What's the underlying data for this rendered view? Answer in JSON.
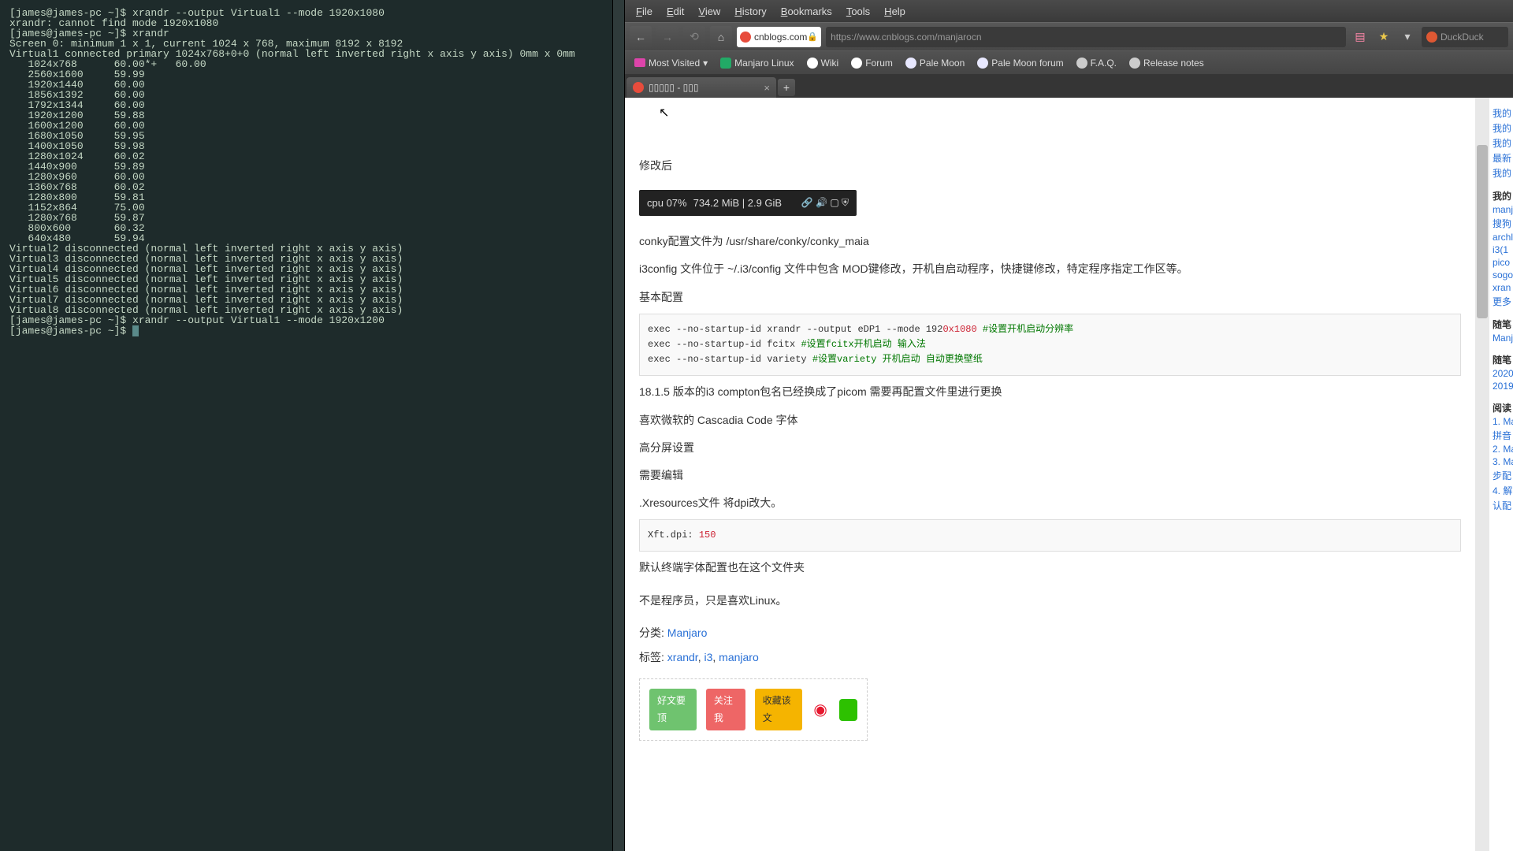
{
  "terminal": {
    "prompt": "[james@james-pc ~]$ ",
    "cmd1": "xrandr --output Virtual1 --mode 1920x1080",
    "err1": "xrandr: cannot find mode 1920x1080",
    "cmd2": "xrandr",
    "screen": "Screen 0: minimum 1 x 1, current 1024 x 768, maximum 8192 x 8192",
    "v1": "Virtual1 connected primary 1024x768+0+0 (normal left inverted right x axis y axis) 0mm x 0mm",
    "modes": [
      [
        "1024x768",
        "60.00*+",
        "60.00"
      ],
      [
        "2560x1600",
        "59.99",
        ""
      ],
      [
        "1920x1440",
        "60.00",
        ""
      ],
      [
        "1856x1392",
        "60.00",
        ""
      ],
      [
        "1792x1344",
        "60.00",
        ""
      ],
      [
        "1920x1200",
        "59.88",
        ""
      ],
      [
        "1600x1200",
        "60.00",
        ""
      ],
      [
        "1680x1050",
        "59.95",
        ""
      ],
      [
        "1400x1050",
        "59.98",
        ""
      ],
      [
        "1280x1024",
        "60.02",
        ""
      ],
      [
        "1440x900",
        "59.89",
        ""
      ],
      [
        "1280x960",
        "60.00",
        ""
      ],
      [
        "1360x768",
        "60.02",
        ""
      ],
      [
        "1280x800",
        "59.81",
        ""
      ],
      [
        "1152x864",
        "75.00",
        ""
      ],
      [
        "1280x768",
        "59.87",
        ""
      ],
      [
        "800x600",
        "60.32",
        ""
      ],
      [
        "640x480",
        "59.94",
        ""
      ]
    ],
    "disconn": [
      "Virtual2 disconnected (normal left inverted right x axis y axis)",
      "Virtual3 disconnected (normal left inverted right x axis y axis)",
      "Virtual4 disconnected (normal left inverted right x axis y axis)",
      "Virtual5 disconnected (normal left inverted right x axis y axis)",
      "Virtual6 disconnected (normal left inverted right x axis y axis)",
      "Virtual7 disconnected (normal left inverted right x axis y axis)",
      "Virtual8 disconnected (normal left inverted right x axis y axis)"
    ],
    "cmd3": "xrandr --output Virtual1 --mode 1920x1200"
  },
  "browser": {
    "menu": [
      "File",
      "Edit",
      "View",
      "History",
      "Bookmarks",
      "Tools",
      "Help"
    ],
    "url_domain": "cnblogs.com",
    "url_full": "https://www.cnblogs.com/manjarocn",
    "search_placeholder": "DuckDuck",
    "bookmarks": [
      "Most Visited",
      "Manjaro Linux",
      "Wiki",
      "Forum",
      "Pale Moon",
      "Pale Moon forum",
      "F.A.Q.",
      "Release notes"
    ],
    "tab_title": "▯▯▯▯▯ - ▯▯▯"
  },
  "page": {
    "after_mod": "修改后",
    "status": {
      "cpu": "cpu  07%",
      "mem": "734.2 MiB | 2.9 GiB"
    },
    "conky_line": "conky配置文件为  /usr/share/conky/conky_maia",
    "i3config": "i3config 文件位于 ~/.i3/config     文件中包含 MOD键修改，开机自启动程序，快捷键修改，特定程序指定工作区等。",
    "basic_cfg": "基本配置",
    "code1_l1a": "exec --no-startup-id xrandr --output eDP1 --mode 192",
    "code1_l1b": "0x1080",
    "code1_l1c": " #设置开机启动分辨率",
    "code1_l2a": "exec --no-startup-id fcitx ",
    "code1_l2b": "#设置fcitx开机启动 输入法",
    "code1_l3a": "exec --no-startup-id variety ",
    "code1_l3b": "#设置variety 开机启动 自动更换壁纸",
    "line_1815": "18.1.5 版本的i3 compton包名已经换成了picom 需要再配置文件里进行更换",
    "line_cascadia": "喜欢微软的 Cascadia Code 字体",
    "line_hidpi": "高分屏设置",
    "line_need": "需要编辑",
    "line_xres": ".Xresources文件 将dpi改大。",
    "code2_a": "Xft.dpi: ",
    "code2_b": "150",
    "line_term": "默认终端字体配置也在这个文件夹",
    "line_not": "不是程序员，只是喜欢Linux。",
    "cat_label": "分类: ",
    "cat_link": "Manjaro",
    "tag_label": "标签: ",
    "tags": [
      "xrandr",
      "i3",
      "manjaro"
    ],
    "actions": [
      "好文要顶",
      "关注我",
      "收藏该文"
    ]
  },
  "sidebar": {
    "my": [
      "我的",
      "我的",
      "我的",
      "最新",
      "我的"
    ],
    "tags_hdr": "我的",
    "tags": [
      "manj",
      "搜狗",
      "archl",
      "i3(1",
      "pico",
      "sogo",
      "xran",
      "更多"
    ],
    "essay_hdr": "随笔",
    "essay": [
      "Manj"
    ],
    "arch_hdr": "随笔",
    "arch": [
      "2020",
      "2019"
    ],
    "rank_hdr": "阅读",
    "rank": [
      "1. Ma",
      "拼音",
      "2. Ma",
      "3. Ma",
      "步配",
      "4. 解",
      "认配"
    ]
  }
}
